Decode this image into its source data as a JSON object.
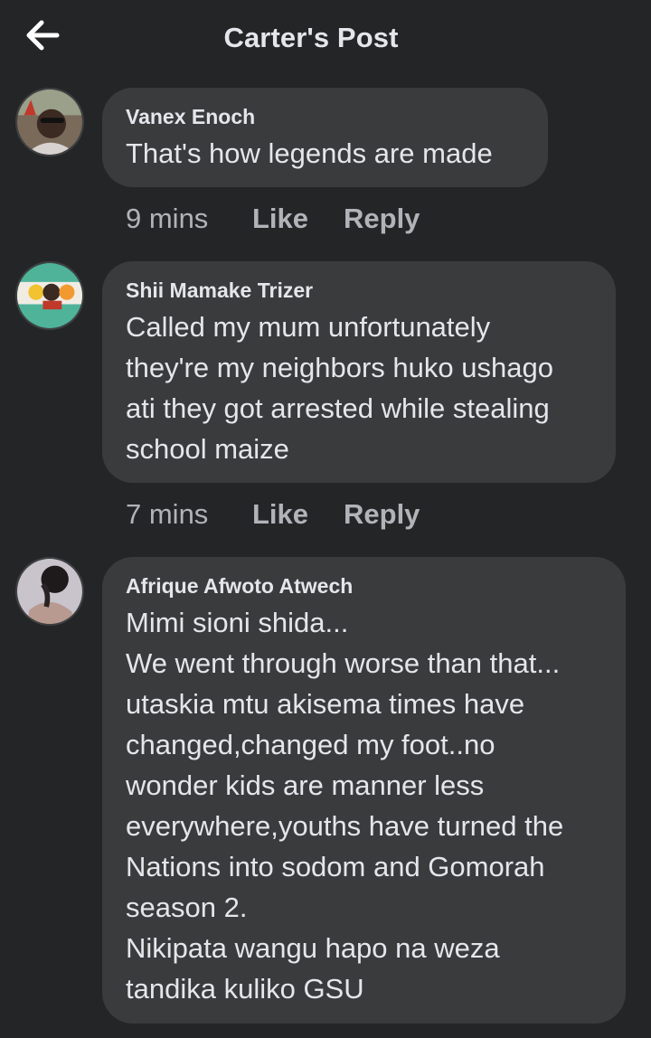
{
  "header": {
    "title": "Carter's Post",
    "back_icon": "arrow-left-icon"
  },
  "comments": [
    {
      "author": "Vanex Enoch",
      "text": "That's how legends are made",
      "time": "9 mins",
      "like_label": "Like",
      "reply_label": "Reply",
      "avatar_icon": "user-avatar-photo"
    },
    {
      "author": "Shii Mamake Trizer",
      "text": "Called my mum unfortunately\nthey're my neighbors huko ushago\nati they got arrested while stealing\nschool maize",
      "time": "7 mins",
      "like_label": "Like",
      "reply_label": "Reply",
      "avatar_icon": "user-avatar-photo"
    },
    {
      "author": "Afrique Afwoto Atwech",
      "text": "Mimi sioni shida...\nWe went through worse than that...\nutaskia mtu akisema times have\nchanged,changed my foot..no\nwonder kids are manner less\neverywhere,youths have turned the\nNations into sodom and Gomorah\nseason 2.\nNikipata wangu hapo na weza\ntandika kuliko GSU",
      "avatar_icon": "user-avatar-photo"
    }
  ],
  "colors": {
    "background": "#242526",
    "bubble": "#3a3b3c",
    "primary_text": "#e4e6eb",
    "secondary_text": "#b0b3b8"
  }
}
